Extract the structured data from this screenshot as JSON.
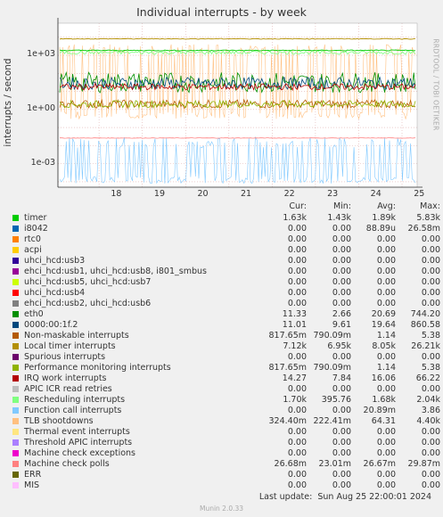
{
  "title": "Individual interrupts - by week",
  "side_label": "RRDTOOL / TOBI OETIKER",
  "footer": {
    "last_update_label": "Last update:",
    "last_update_value": "Sun Aug 25 22:00:01 2024",
    "version": "Munin 2.0.33"
  },
  "chart_data": {
    "type": "line",
    "ylabel": "interrupts / second",
    "yscale": "log",
    "ylim": [
      5e-05,
      60000
    ],
    "yticks": [
      {
        "value": 1000,
        "label": "1e+03"
      },
      {
        "value": 1,
        "label": "1e+00"
      },
      {
        "value": 0.001,
        "label": "1e-03"
      }
    ],
    "xticks": [
      "18",
      "19",
      "20",
      "21",
      "22",
      "23",
      "24",
      "25"
    ],
    "grid": true,
    "columns": [
      "Cur:",
      "Min:",
      "Avg:",
      "Max:"
    ],
    "series": [
      {
        "name": "timer",
        "color": "#00cc00",
        "cur": "1.63k",
        "min": "1.43k",
        "avg": "1.89k",
        "max": "5.83k"
      },
      {
        "name": "i8042",
        "color": "#0066b3",
        "cur": "0.00",
        "min": "0.00",
        "avg": "88.89u",
        "max": "26.58m"
      },
      {
        "name": "rtc0",
        "color": "#ff8000",
        "cur": "0.00",
        "min": "0.00",
        "avg": "0.00",
        "max": "0.00"
      },
      {
        "name": "acpi",
        "color": "#ffcc00",
        "cur": "0.00",
        "min": "0.00",
        "avg": "0.00",
        "max": "0.00"
      },
      {
        "name": "uhci_hcd:usb3",
        "color": "#330099",
        "cur": "0.00",
        "min": "0.00",
        "avg": "0.00",
        "max": "0.00"
      },
      {
        "name": "ehci_hcd:usb1, uhci_hcd:usb8, i801_smbus",
        "color": "#990099",
        "cur": "0.00",
        "min": "0.00",
        "avg": "0.00",
        "max": "0.00"
      },
      {
        "name": "uhci_hcd:usb5, uhci_hcd:usb7",
        "color": "#ccff00",
        "cur": "0.00",
        "min": "0.00",
        "avg": "0.00",
        "max": "0.00"
      },
      {
        "name": "uhci_hcd:usb4",
        "color": "#ff0000",
        "cur": "0.00",
        "min": "0.00",
        "avg": "0.00",
        "max": "0.00"
      },
      {
        "name": "ehci_hcd:usb2, uhci_hcd:usb6",
        "color": "#808080",
        "cur": "0.00",
        "min": "0.00",
        "avg": "0.00",
        "max": "0.00"
      },
      {
        "name": "eth0",
        "color": "#008f00",
        "cur": "11.33",
        "min": "2.66",
        "avg": "20.69",
        "max": "744.20"
      },
      {
        "name": "0000:00:1f.2",
        "color": "#00487d",
        "cur": "11.01",
        "min": "9.61",
        "avg": "19.64",
        "max": "860.58"
      },
      {
        "name": "Non-maskable interrupts",
        "color": "#b35a00",
        "cur": "817.65m",
        "min": "790.09m",
        "avg": "1.14",
        "max": "5.38"
      },
      {
        "name": "Local timer interrupts",
        "color": "#b38f00",
        "cur": "7.12k",
        "min": "6.95k",
        "avg": "8.05k",
        "max": "26.21k"
      },
      {
        "name": "Spurious interrupts",
        "color": "#6b006b",
        "cur": "0.00",
        "min": "0.00",
        "avg": "0.00",
        "max": "0.00"
      },
      {
        "name": "Performance monitoring interrupts",
        "color": "#8fb300",
        "cur": "817.65m",
        "min": "790.09m",
        "avg": "1.14",
        "max": "5.38"
      },
      {
        "name": "IRQ work interrupts",
        "color": "#b30000",
        "cur": "14.27",
        "min": "7.84",
        "avg": "16.06",
        "max": "66.22"
      },
      {
        "name": "APIC ICR read retries",
        "color": "#bebebe",
        "cur": "0.00",
        "min": "0.00",
        "avg": "0.00",
        "max": "0.00"
      },
      {
        "name": "Rescheduling interrupts",
        "color": "#80ff80",
        "cur": "1.70k",
        "min": "395.76",
        "avg": "1.68k",
        "max": "2.04k"
      },
      {
        "name": "Function call interrupts",
        "color": "#80c9ff",
        "cur": "0.00",
        "min": "0.00",
        "avg": "20.89m",
        "max": "3.86"
      },
      {
        "name": "TLB shootdowns",
        "color": "#ffc080",
        "cur": "324.40m",
        "min": "222.41m",
        "avg": "64.31",
        "max": "4.40k"
      },
      {
        "name": "Thermal event interrupts",
        "color": "#ffe680",
        "cur": "0.00",
        "min": "0.00",
        "avg": "0.00",
        "max": "0.00"
      },
      {
        "name": "Threshold APIC interrupts",
        "color": "#aa80ff",
        "cur": "0.00",
        "min": "0.00",
        "avg": "0.00",
        "max": "0.00"
      },
      {
        "name": "Machine check exceptions",
        "color": "#ee00cc",
        "cur": "0.00",
        "min": "0.00",
        "avg": "0.00",
        "max": "0.00"
      },
      {
        "name": "Machine check polls",
        "color": "#ff8080",
        "cur": "26.68m",
        "min": "23.01m",
        "avg": "26.67m",
        "max": "29.87m"
      },
      {
        "name": "ERR",
        "color": "#666600",
        "cur": "0.00",
        "min": "0.00",
        "avg": "0.00",
        "max": "0.00"
      },
      {
        "name": "MIS",
        "color": "#ffbfff",
        "cur": "0.00",
        "min": "0.00",
        "avg": "0.00",
        "max": "0.00"
      }
    ]
  }
}
